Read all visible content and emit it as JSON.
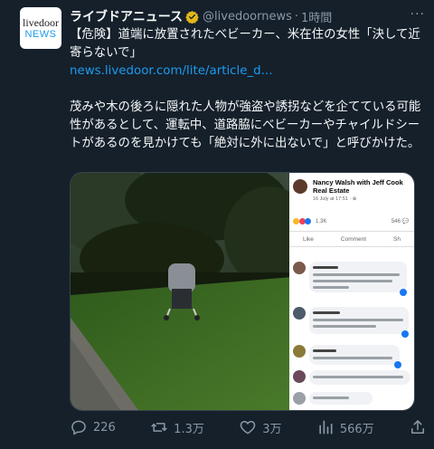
{
  "tweet": {
    "author_name": "ライブドアニュース",
    "handle": "@livedoornews",
    "separator": "·",
    "time": "1時間",
    "more": "···",
    "avatar": {
      "line1": "livedoor",
      "line2": "NEWS"
    },
    "text": {
      "headline": "【危険】道端に放置されたベビーカー、米在住の女性「決して近寄らないで」",
      "link": "news.livedoor.com/lite/article_d...",
      "body": "茂みや木の後ろに隠れた人物が強盗や誘拐などを企てている可能性があるとして、運転中、道路脇にベビーカーやチャイルドシートがあるのを見かけても「絶対に外に出ないで」と呼びかけた。"
    },
    "media": {
      "facebook_post": {
        "author": "Nancy Walsh with Jeff Cook Real Estate",
        "date": "16 July at 17:51 · ⊕",
        "reaction_count": "1.3K",
        "comment_count": "546 💬",
        "actions": [
          "Like",
          "Comment",
          "Sh"
        ]
      }
    },
    "actions": {
      "replies": "226",
      "retweets": "1.3万",
      "likes": "3万",
      "views": "566万"
    }
  },
  "colors": {
    "background": "#15202b",
    "accent": "#1d9bf0",
    "muted": "#8b98a5",
    "verified": "#e2b719"
  }
}
